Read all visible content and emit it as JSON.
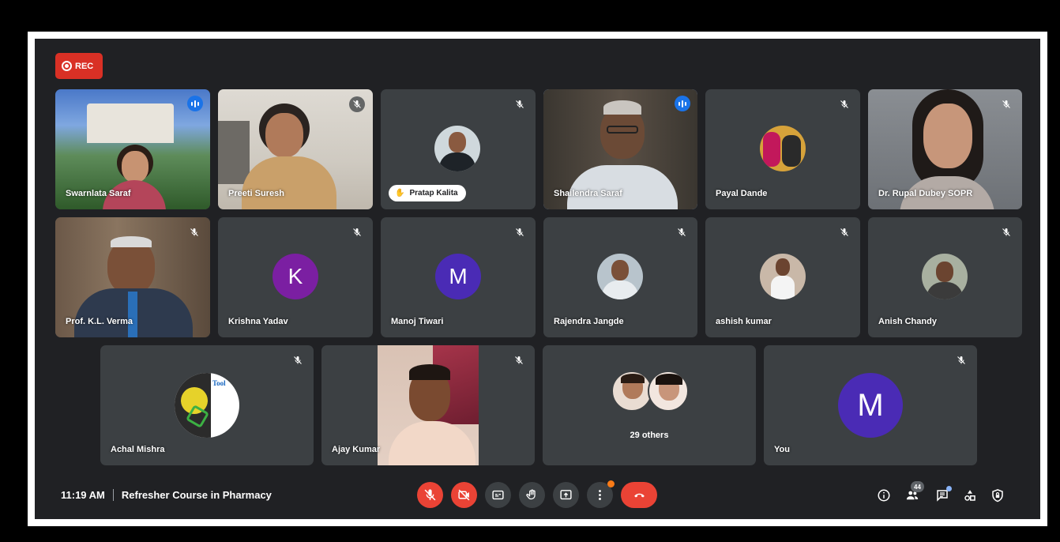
{
  "recording": {
    "label": "REC"
  },
  "participants": [
    {
      "name": "Swarnlata Saraf"
    },
    {
      "name": "Preeti Suresh"
    },
    {
      "name": "Pratap Kalita"
    },
    {
      "name": "Shailendra Saraf"
    },
    {
      "name": "Payal Dande"
    },
    {
      "name": "Dr. Rupal Dubey SOPR"
    },
    {
      "name": "Prof. K.L. Verma"
    },
    {
      "name": "Krishna Yadav",
      "initial": "K"
    },
    {
      "name": "Manoj Tiwari",
      "initial": "M"
    },
    {
      "name": "Rajendra Jangde"
    },
    {
      "name": "ashish kumar"
    },
    {
      "name": "Anish Chandy"
    },
    {
      "name": "Achal Mishra",
      "avatar_text": "Tool"
    },
    {
      "name": "Ajay Kumar"
    },
    {
      "name": "29 others"
    },
    {
      "name": "You",
      "initial": "M"
    }
  ],
  "footer": {
    "time": "11:19 AM",
    "meeting_title": "Refresher Course in Pharmacy",
    "people_count": "44"
  },
  "colors": {
    "background": "#202124",
    "tile": "#3c4043",
    "danger": "#ea4335",
    "speaking": "#1a73e8",
    "avatar_purple": "#7b1fa2",
    "avatar_indigo": "#4a2bb5"
  }
}
